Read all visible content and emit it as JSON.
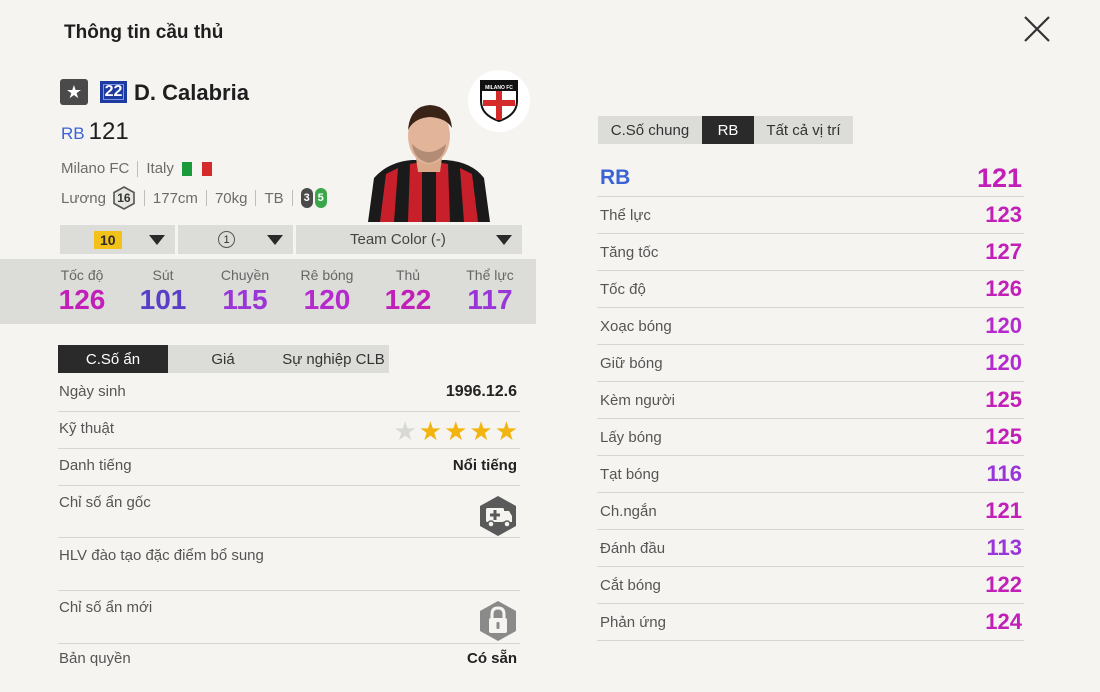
{
  "window": {
    "title": "Thông tin cầu thủ",
    "close_icon": "close-icon"
  },
  "player": {
    "name": "D. Calabria",
    "number": "22",
    "position": "RB",
    "ovr": "121",
    "club": "Milano FC",
    "nation": "Italy",
    "salary_label": "Lương",
    "salary": "16",
    "height": "177cm",
    "weight": "70kg",
    "body": "TB",
    "weak_foot": "3",
    "strong_foot": "5",
    "club_logo_text": "MILANO FC"
  },
  "selectors": {
    "upgrade": "10",
    "skill": "1",
    "team_color": "Team Color (-)"
  },
  "summary_stats": [
    {
      "label": "Tốc độ",
      "value": "126",
      "color": "#c21fb8"
    },
    {
      "label": "Sút",
      "value": "101",
      "color": "#5a3ec8"
    },
    {
      "label": "Chuyền",
      "value": "115",
      "color": "#9a36d8"
    },
    {
      "label": "Rê bóng",
      "value": "120",
      "color": "#b52acd"
    },
    {
      "label": "Thủ",
      "value": "122",
      "color": "#c21fb8"
    },
    {
      "label": "Thể lực",
      "value": "117",
      "color": "#9a36d8"
    }
  ],
  "left_tabs": [
    {
      "label": "C.Số ẩn",
      "active": true
    },
    {
      "label": "Giá",
      "active": false
    },
    {
      "label": "Sự nghiệp CLB",
      "active": false
    }
  ],
  "info": {
    "birth_label": "Ngày sinh",
    "birth": "1996.12.6",
    "skill_label": "Kỹ thuật",
    "skill_stars": 4,
    "fame_label": "Danh tiếng",
    "fame": "Nổi tiếng",
    "hidden_orig_label": "Chỉ số ẩn gốc",
    "coach_label": "HLV đào tạo đặc điểm bổ sung",
    "hidden_new_label": "Chỉ số ẩn mới",
    "license_label": "Bản quyền",
    "license": "Có sẵn"
  },
  "right_tabs": [
    {
      "label": "C.Số chung",
      "active": false
    },
    {
      "label": "RB",
      "active": true
    },
    {
      "label": "Tất cả vị trí",
      "active": false
    }
  ],
  "position_stats": [
    {
      "label": "RB",
      "value": "121",
      "color": "#c21fb8"
    },
    {
      "label": "Thể lực",
      "value": "123",
      "color": "#c21fb8"
    },
    {
      "label": "Tăng tốc",
      "value": "127",
      "color": "#c21fb8"
    },
    {
      "label": "Tốc độ",
      "value": "126",
      "color": "#c21fb8"
    },
    {
      "label": "Xoạc bóng",
      "value": "120",
      "color": "#b52acd"
    },
    {
      "label": "Giữ bóng",
      "value": "120",
      "color": "#b52acd"
    },
    {
      "label": "Kèm người",
      "value": "125",
      "color": "#c21fb8"
    },
    {
      "label": "Lấy bóng",
      "value": "125",
      "color": "#c21fb8"
    },
    {
      "label": "Tạt bóng",
      "value": "116",
      "color": "#9a36d8"
    },
    {
      "label": "Ch.ngắn",
      "value": "121",
      "color": "#c21fb8"
    },
    {
      "label": "Đánh đầu",
      "value": "113",
      "color": "#9a36d8"
    },
    {
      "label": "Cắt bóng",
      "value": "122",
      "color": "#c21fb8"
    },
    {
      "label": "Phản ứng",
      "value": "124",
      "color": "#c21fb8"
    }
  ]
}
